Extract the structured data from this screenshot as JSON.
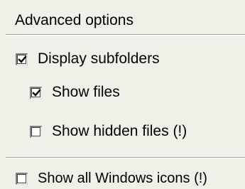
{
  "panel": {
    "title": "Advanced options",
    "options": [
      {
        "label": "Display subfolders",
        "checked": true
      },
      {
        "label": "Show files",
        "checked": true
      },
      {
        "label": "Show hidden files (!)",
        "checked": false
      },
      {
        "label": "Show all Windows icons (!)",
        "checked": false
      }
    ]
  },
  "icons": {
    "check": "checkmark-icon"
  }
}
